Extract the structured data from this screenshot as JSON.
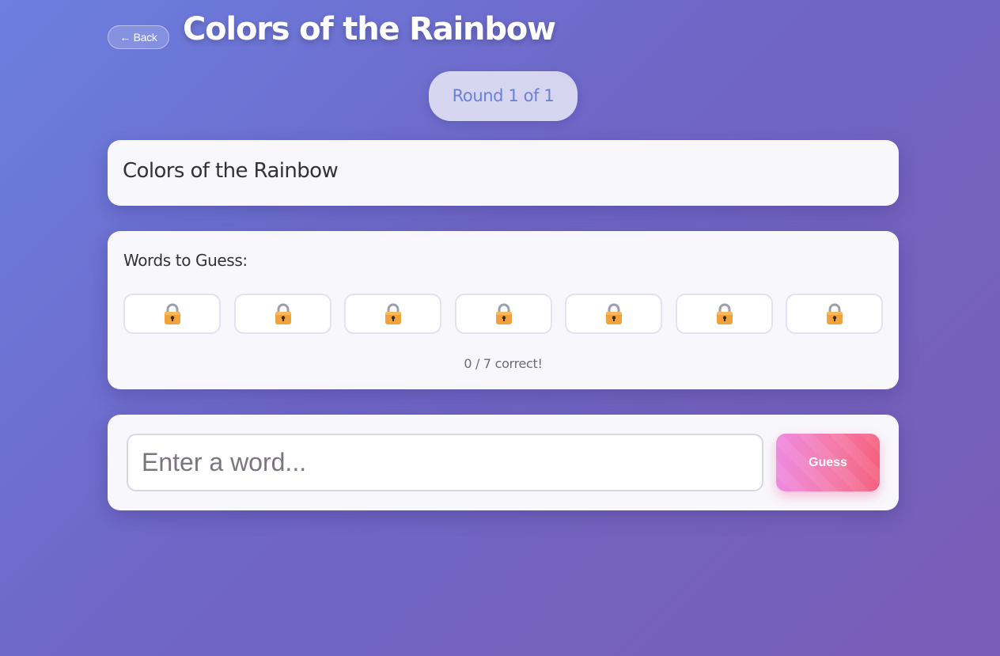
{
  "header": {
    "back_label": "← Back",
    "title": "Colors of the Rainbow"
  },
  "round": {
    "label": "Round 1 of 1"
  },
  "topic": {
    "title": "Colors of the Rainbow"
  },
  "words": {
    "heading": "Words to Guess:",
    "slots": [
      {
        "state": "locked",
        "icon": "lock-icon"
      },
      {
        "state": "locked",
        "icon": "lock-icon"
      },
      {
        "state": "locked",
        "icon": "lock-icon"
      },
      {
        "state": "locked",
        "icon": "lock-icon"
      },
      {
        "state": "locked",
        "icon": "lock-icon"
      },
      {
        "state": "locked",
        "icon": "lock-icon"
      },
      {
        "state": "locked",
        "icon": "lock-icon"
      }
    ],
    "progress": "0 / 7 correct!"
  },
  "guess": {
    "placeholder": "Enter a word...",
    "value": "",
    "button_label": "Guess"
  },
  "colors": {
    "background_start": "#6b7fe0",
    "background_end": "#7a5db7",
    "accent_blue": "#6b7fd8",
    "button_pink": "#ee8ae0",
    "button_red": "#f5607e",
    "lock_body": "#f2a23c",
    "lock_shackle": "#9aa0ad"
  }
}
